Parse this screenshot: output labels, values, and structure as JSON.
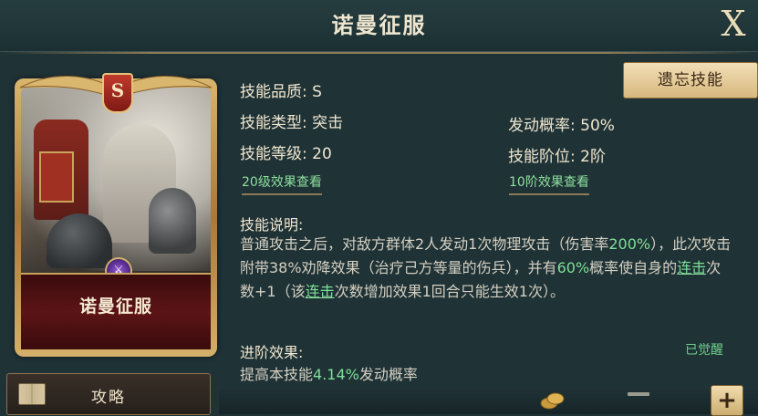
{
  "header": {
    "title": "诺曼征服",
    "close_label": "X"
  },
  "card": {
    "grade_badge": "S",
    "name": "诺曼征服",
    "emblem": "⚔"
  },
  "guide": {
    "label": "攻略",
    "icon": "book-icon"
  },
  "actions": {
    "forget_label": "遗忘技能"
  },
  "skill": {
    "quality": "技能品质: S",
    "type": "技能类型: 突击",
    "level": "技能等级: 20",
    "trigger_rate": "发动概率: 50%",
    "tier": "技能阶位: 2阶",
    "level_link": "20级效果查看",
    "tier_link": "10阶效果查看"
  },
  "description": {
    "title": "技能说明:",
    "p1": "普通攻击之后，对敌方群体2人发动1次物理攻击（伤害率",
    "v1": "200%",
    "p2": "），此次攻击附带38%劝降效果（治疗己方等量的伤兵），并有",
    "v2": "60%",
    "p3": "概率使自身的",
    "link1": "连击",
    "p4": "次数+1（该",
    "link2": "连击",
    "p5": "次数增加效果1回合只能生效1次）。"
  },
  "advance": {
    "title": "进阶效果:",
    "status": "已觉醒",
    "p1": "提高本技能",
    "value": "4.14%",
    "p2": "发动概率"
  },
  "controls": {
    "plus_label": "+"
  },
  "colors": {
    "accent_green": "#7ee096",
    "gold": "#d7b97e",
    "background": "#1f3236"
  }
}
